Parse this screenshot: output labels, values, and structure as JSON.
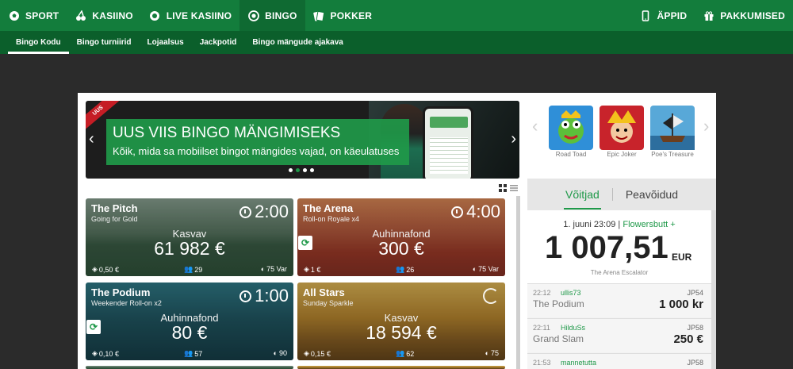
{
  "topnav": {
    "items": [
      {
        "label": "SPORT",
        "icon": "soccer-ball-icon"
      },
      {
        "label": "KASIINO",
        "icon": "cherries-icon"
      },
      {
        "label": "LIVE KASIINO",
        "icon": "poker-chip-icon"
      },
      {
        "label": "BINGO",
        "icon": "bingo-ball-icon",
        "active": true
      },
      {
        "label": "POKKER",
        "icon": "cards-icon"
      }
    ],
    "right": [
      {
        "label": "ÄPPID",
        "icon": "phone-icon"
      },
      {
        "label": "PAKKUMISED",
        "icon": "gift-icon"
      }
    ]
  },
  "subnav": {
    "items": [
      "Bingo Kodu",
      "Bingo turniirid",
      "Lojaalsus",
      "Jackpotid",
      "Bingo mängude ajakava"
    ],
    "active_index": 0
  },
  "hero": {
    "ribbon": "UUS",
    "title": "UUS VIIS BINGO MÄNGIMISEKS",
    "subtitle": "Kõik, mida sa mobiilset bingot mängides vajad, on käeulatuses",
    "prev": "‹",
    "next": "›",
    "dots": 4,
    "active_dot": 1
  },
  "rooms": [
    {
      "name": "The Pitch",
      "sub": "Going for Gold",
      "timer": "2:00",
      "prize_label": "Kasvav",
      "prize": "61 982 €",
      "price": "0,50 €",
      "players": "29",
      "balls": "75 Var",
      "theme": "pitch",
      "roll": false
    },
    {
      "name": "The Arena",
      "sub": "Roll-on Royale x4",
      "timer": "4:00",
      "prize_label": "Auhinnafond",
      "prize": "300 €",
      "price": "1 €",
      "players": "26",
      "balls": "75 Var",
      "theme": "arena",
      "roll": true
    },
    {
      "name": "The Podium",
      "sub": "Weekender Roll-on x2",
      "timer": "1:00",
      "prize_label": "Auhinnafond",
      "prize": "80 €",
      "price": "0,10 €",
      "players": "57",
      "balls": "90",
      "theme": "podium",
      "roll": true
    },
    {
      "name": "All Stars",
      "sub": "Sunday Sparkle",
      "timer": "",
      "prize_label": "Kasvav",
      "prize": "18 594 €",
      "price": "0,15 €",
      "players": "62",
      "balls": "75",
      "theme": "allstars",
      "roll": false
    }
  ],
  "games": [
    {
      "label": "Road Toad",
      "color": "#2f8fd8"
    },
    {
      "label": "Epic Joker",
      "color": "#c8232b"
    },
    {
      "label": "Poe's Treasure",
      "color": "#58a8d8"
    }
  ],
  "tabs": {
    "winners": "Võitjad",
    "jackpots": "Peavõidud"
  },
  "winner": {
    "datetime": "1. juuni 23:09",
    "user": "Flowersbutt +",
    "amount": "1 007,51",
    "currency": "EUR",
    "game": "The Arena  Escalator"
  },
  "winner_rows": [
    {
      "time": "22:12",
      "user": "ullis73",
      "jp": "JP54",
      "game": "The Podium",
      "prize": "1 000 kr"
    },
    {
      "time": "22:11",
      "user": "HilduSs",
      "jp": "JP58",
      "game": "Grand Slam",
      "prize": "250 €"
    },
    {
      "time": "21:53",
      "user": "mannetutta",
      "jp": "JP58",
      "game": "",
      "prize": ""
    }
  ],
  "colors": {
    "brand_green": "#137d3c",
    "accent_green": "#1f9949",
    "background": "#2b2b2b"
  }
}
